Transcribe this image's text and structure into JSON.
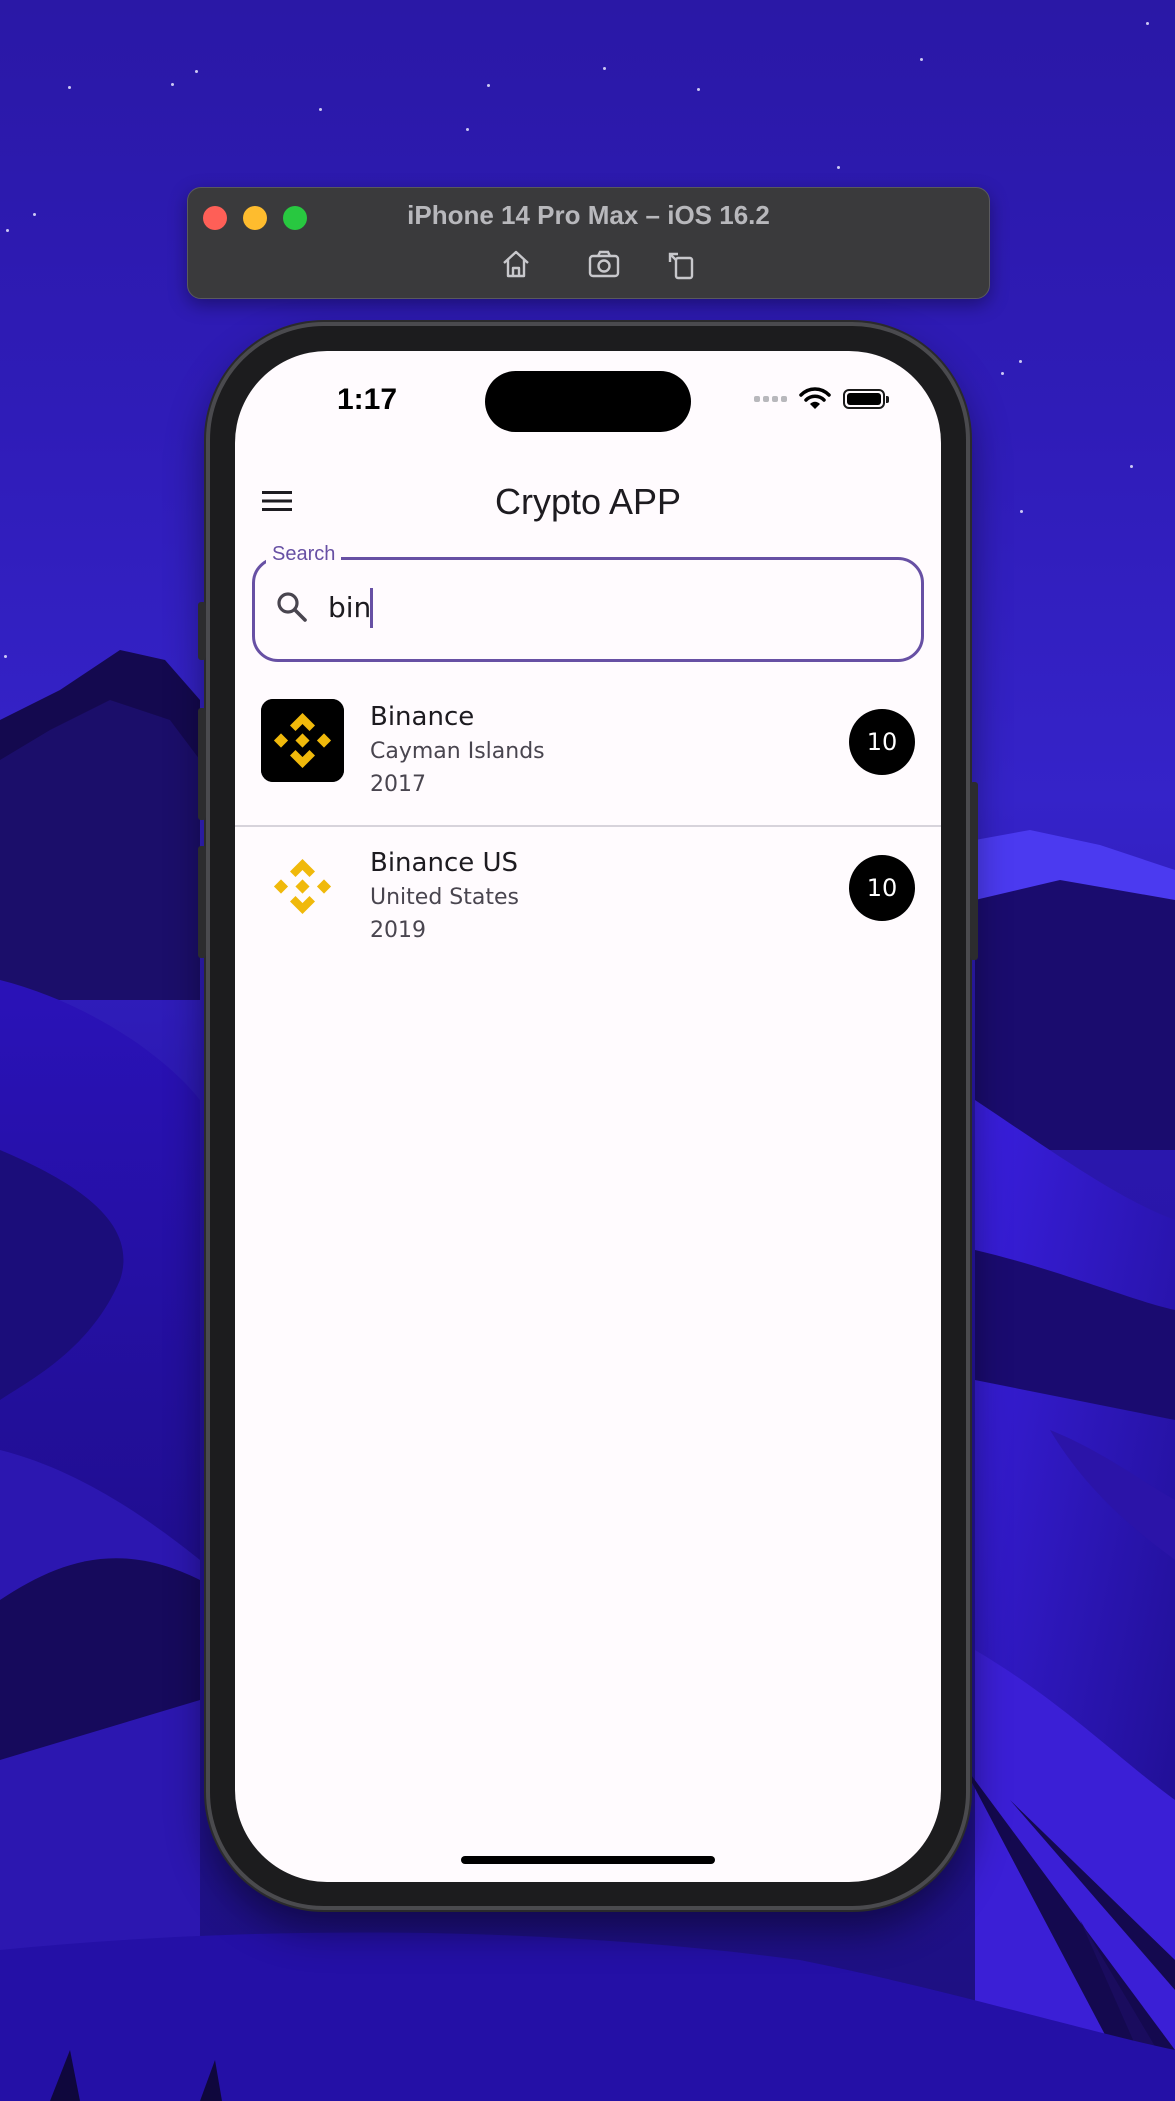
{
  "simulator": {
    "title": "iPhone 14 Pro Max – iOS 16.2",
    "tools": [
      "home-icon",
      "screenshot-icon",
      "rotate-icon"
    ]
  },
  "status_bar": {
    "time": "1:17"
  },
  "app": {
    "title": "Crypto APP",
    "accent_color": "#6750a4"
  },
  "search": {
    "label": "Search",
    "value": "bin"
  },
  "exchanges": [
    {
      "name": "Binance",
      "country": "Cayman Islands",
      "year": "2017",
      "rank": "10",
      "logo": "binance-logo-dark"
    },
    {
      "name": "Binance US",
      "country": "United States",
      "year": "2019",
      "rank": "10",
      "logo": "binance-logo-light"
    }
  ]
}
